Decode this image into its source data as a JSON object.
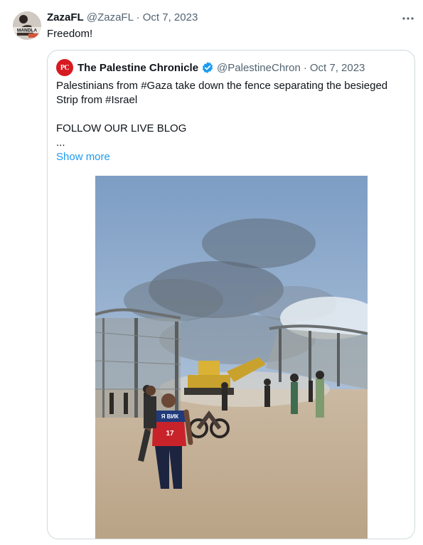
{
  "tweet": {
    "author_name": "ZazaFL",
    "handle": "@ZazaFL",
    "separator": "·",
    "date": "Oct 7, 2023",
    "text": "Freedom!",
    "avatar_text": "MANDLA",
    "more_icon": "more-horizontal-icon"
  },
  "quoted": {
    "author_name": "The Palestine Chronicle",
    "avatar_text": "PC",
    "verified_icon": "verified-badge-icon",
    "verified_color": "#1d9bf0",
    "handle": "@PalestineChron",
    "separator": "·",
    "date": "Oct 7, 2023",
    "text_lines": [
      "Palestinians from #Gaza take down the fence separating the besieged",
      "Strip from #Israel",
      "",
      "FOLLOW OUR LIVE BLOG",
      "..."
    ],
    "show_more": "Show more",
    "media": {
      "type": "photo",
      "overlay_text": [
        "Я ВИК",
        "17"
      ]
    }
  },
  "colors": {
    "text": "#0f1419",
    "muted": "#536471",
    "link": "#1d9bf0",
    "border": "#cfd9de",
    "brand_red": "#d71920"
  }
}
